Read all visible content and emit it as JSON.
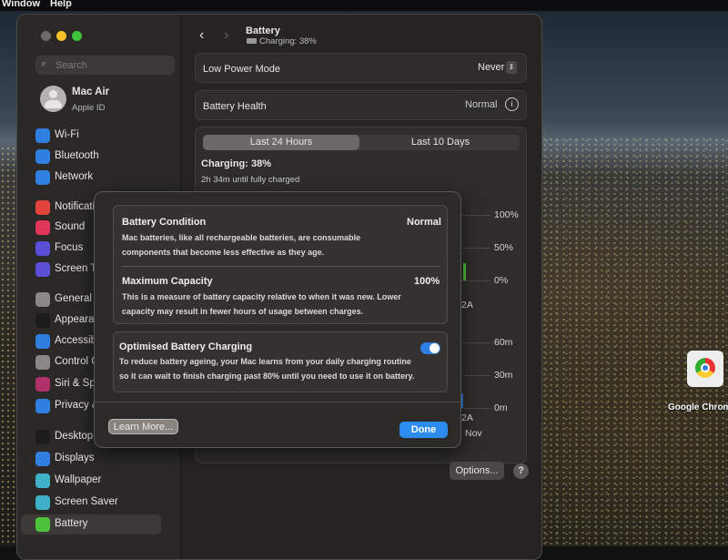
{
  "menubar": {
    "items": [
      "Window",
      "Help"
    ]
  },
  "sidebar": {
    "search_placeholder": "Search",
    "account": {
      "name": "Mac Air",
      "subtitle": "Apple ID"
    },
    "items": [
      {
        "label": "Wi-Fi",
        "icon": "wifi-icon",
        "color": "#2f7fe0"
      },
      {
        "label": "Bluetooth",
        "icon": "bluetooth-icon",
        "color": "#2f7fe0"
      },
      {
        "label": "Network",
        "icon": "globe-icon",
        "color": "#2f7fe0"
      },
      {
        "label": "Notifications",
        "icon": "bell-icon",
        "color": "#e0443a"
      },
      {
        "label": "Sound",
        "icon": "speaker-icon",
        "color": "#e0365a"
      },
      {
        "label": "Focus",
        "icon": "moon-icon",
        "color": "#5b4fd8"
      },
      {
        "label": "Screen Time",
        "icon": "hourglass-icon",
        "color": "#5b4fd8"
      },
      {
        "label": "General",
        "icon": "gear-icon",
        "color": "#8a8886"
      },
      {
        "label": "Appearance",
        "icon": "appearance-icon",
        "color": "#1c1c1c"
      },
      {
        "label": "Accessibility",
        "icon": "accessibility-icon",
        "color": "#2f7fe0"
      },
      {
        "label": "Control Centre",
        "icon": "control-centre-icon",
        "color": "#8a8886"
      },
      {
        "label": "Siri & Spotlight",
        "icon": "siri-icon",
        "color": "#b0306a"
      },
      {
        "label": "Privacy & Security",
        "icon": "hand-icon",
        "color": "#2f7fe0"
      },
      {
        "label": "Desktop & Dock",
        "icon": "dock-icon",
        "color": "#1c1c1c"
      },
      {
        "label": "Displays",
        "icon": "sun-icon",
        "color": "#2f7fe0"
      },
      {
        "label": "Wallpaper",
        "icon": "wallpaper-icon",
        "color": "#3fb0c8"
      },
      {
        "label": "Screen Saver",
        "icon": "screen-saver-icon",
        "color": "#3fb0c8"
      },
      {
        "label": "Battery",
        "icon": "battery-icon",
        "color": "#4cc23a",
        "selected": true
      }
    ]
  },
  "header": {
    "title": "Battery",
    "subtitle": "Charging: 38%"
  },
  "low_power": {
    "label": "Low Power Mode",
    "value": "Never"
  },
  "health": {
    "label": "Battery Health",
    "value": "Normal"
  },
  "usage": {
    "tabs": [
      "Last 24 Hours",
      "Last 10 Days"
    ],
    "selected_tab": "Last 24 Hours",
    "status": "Charging: 38%",
    "time_remaining": "2h 34m until fully charged",
    "level_axis": [
      "100%",
      "50%",
      "0%"
    ],
    "level_tick": "2A",
    "usage_axis": [
      "60m",
      "30m",
      "0m"
    ],
    "usage_tick": "2A",
    "date_tick": "Nov",
    "colors": {
      "level": "#4cc23a",
      "usage": "#2f7fe0"
    }
  },
  "options_label": "Options...",
  "help_label": "?",
  "dialog": {
    "condition": {
      "title": "Battery Condition",
      "value": "Normal",
      "text1": "Mac batteries, like all rechargeable batteries, are consumable",
      "text2": "components that become less effective as they age."
    },
    "capacity": {
      "title": "Maximum Capacity",
      "value": "100%",
      "text1": "This is a measure of battery capacity relative to when it was new. Lower",
      "text2": "capacity may result in fewer hours of usage between charges."
    },
    "optimised": {
      "title": "Optimised Battery Charging",
      "enabled": true,
      "text1": "To reduce battery ageing, your Mac learns from your daily charging routine",
      "text2": "so it can wait to finish charging past 80% until you need to use it on battery."
    },
    "learn_more": "Learn More...",
    "done": "Done"
  },
  "desktop": {
    "chrome_label": "Google Chrome"
  }
}
